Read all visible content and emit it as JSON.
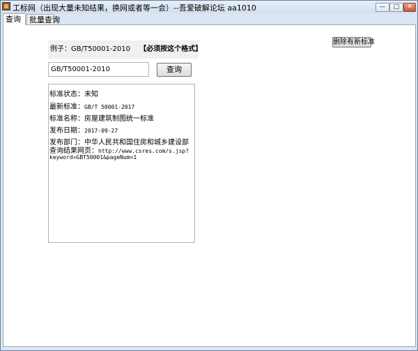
{
  "window": {
    "title": "工标网（出现大量未知结果，换网或者等一会）--吾爱破解论坛 aa1010",
    "buttons": {
      "minimize": "—",
      "maximize": "□",
      "close": "✕"
    }
  },
  "tabs": [
    {
      "label": "查询",
      "active": true
    },
    {
      "label": "批量查询",
      "active": false
    }
  ],
  "example": {
    "prefix": "例子：",
    "value": "GB/T50001-2010",
    "note": "【必须按这个格式】"
  },
  "delete_button": "删除有新标准",
  "search": {
    "value": "GB/T50001-2010",
    "button": "查询"
  },
  "result": {
    "status_label": "标准状态：",
    "status_value": "未知",
    "latest_label": "最新标准：",
    "latest_value": "GB/T 50001-2017",
    "name_label": "标准名称：",
    "name_value": "房屋建筑制图统一标准",
    "date_label": "发布日期：",
    "date_value": "2017-09-27",
    "dept_label": "发布部门：",
    "dept_value": "中华人民共和国住房和城乡建设部",
    "url_label": "查询结果网页：",
    "url_line1": "http://www.csres.com/s.jsp?",
    "url_line2": "keyword=GBT50001&pageNum=1"
  },
  "icons": {
    "app": "app-icon"
  }
}
